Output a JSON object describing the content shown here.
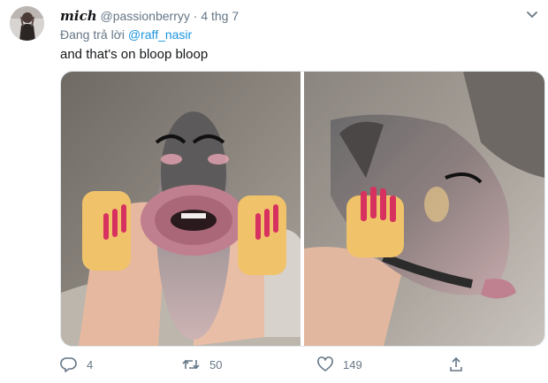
{
  "tweet": {
    "display_name": "mich",
    "handle": "@passionberryy",
    "separator": "·",
    "time": "4 thg 7",
    "reply_prefix": "Đang trả lời",
    "reply_mention": "@raff_nasir",
    "text": "and that's on bloop bloop",
    "avatar_icon": "avatar",
    "more_icon": "chevron-down-icon"
  },
  "actions": {
    "reply_count": "4",
    "retweet_count": "50",
    "like_count": "149",
    "reply_icon": "reply-icon",
    "retweet_icon": "retweet-icon",
    "like_icon": "heart-icon",
    "share_icon": "share-icon"
  },
  "colors": {
    "link": "#1b95e0",
    "muted": "#657786",
    "text": "#14171a"
  }
}
